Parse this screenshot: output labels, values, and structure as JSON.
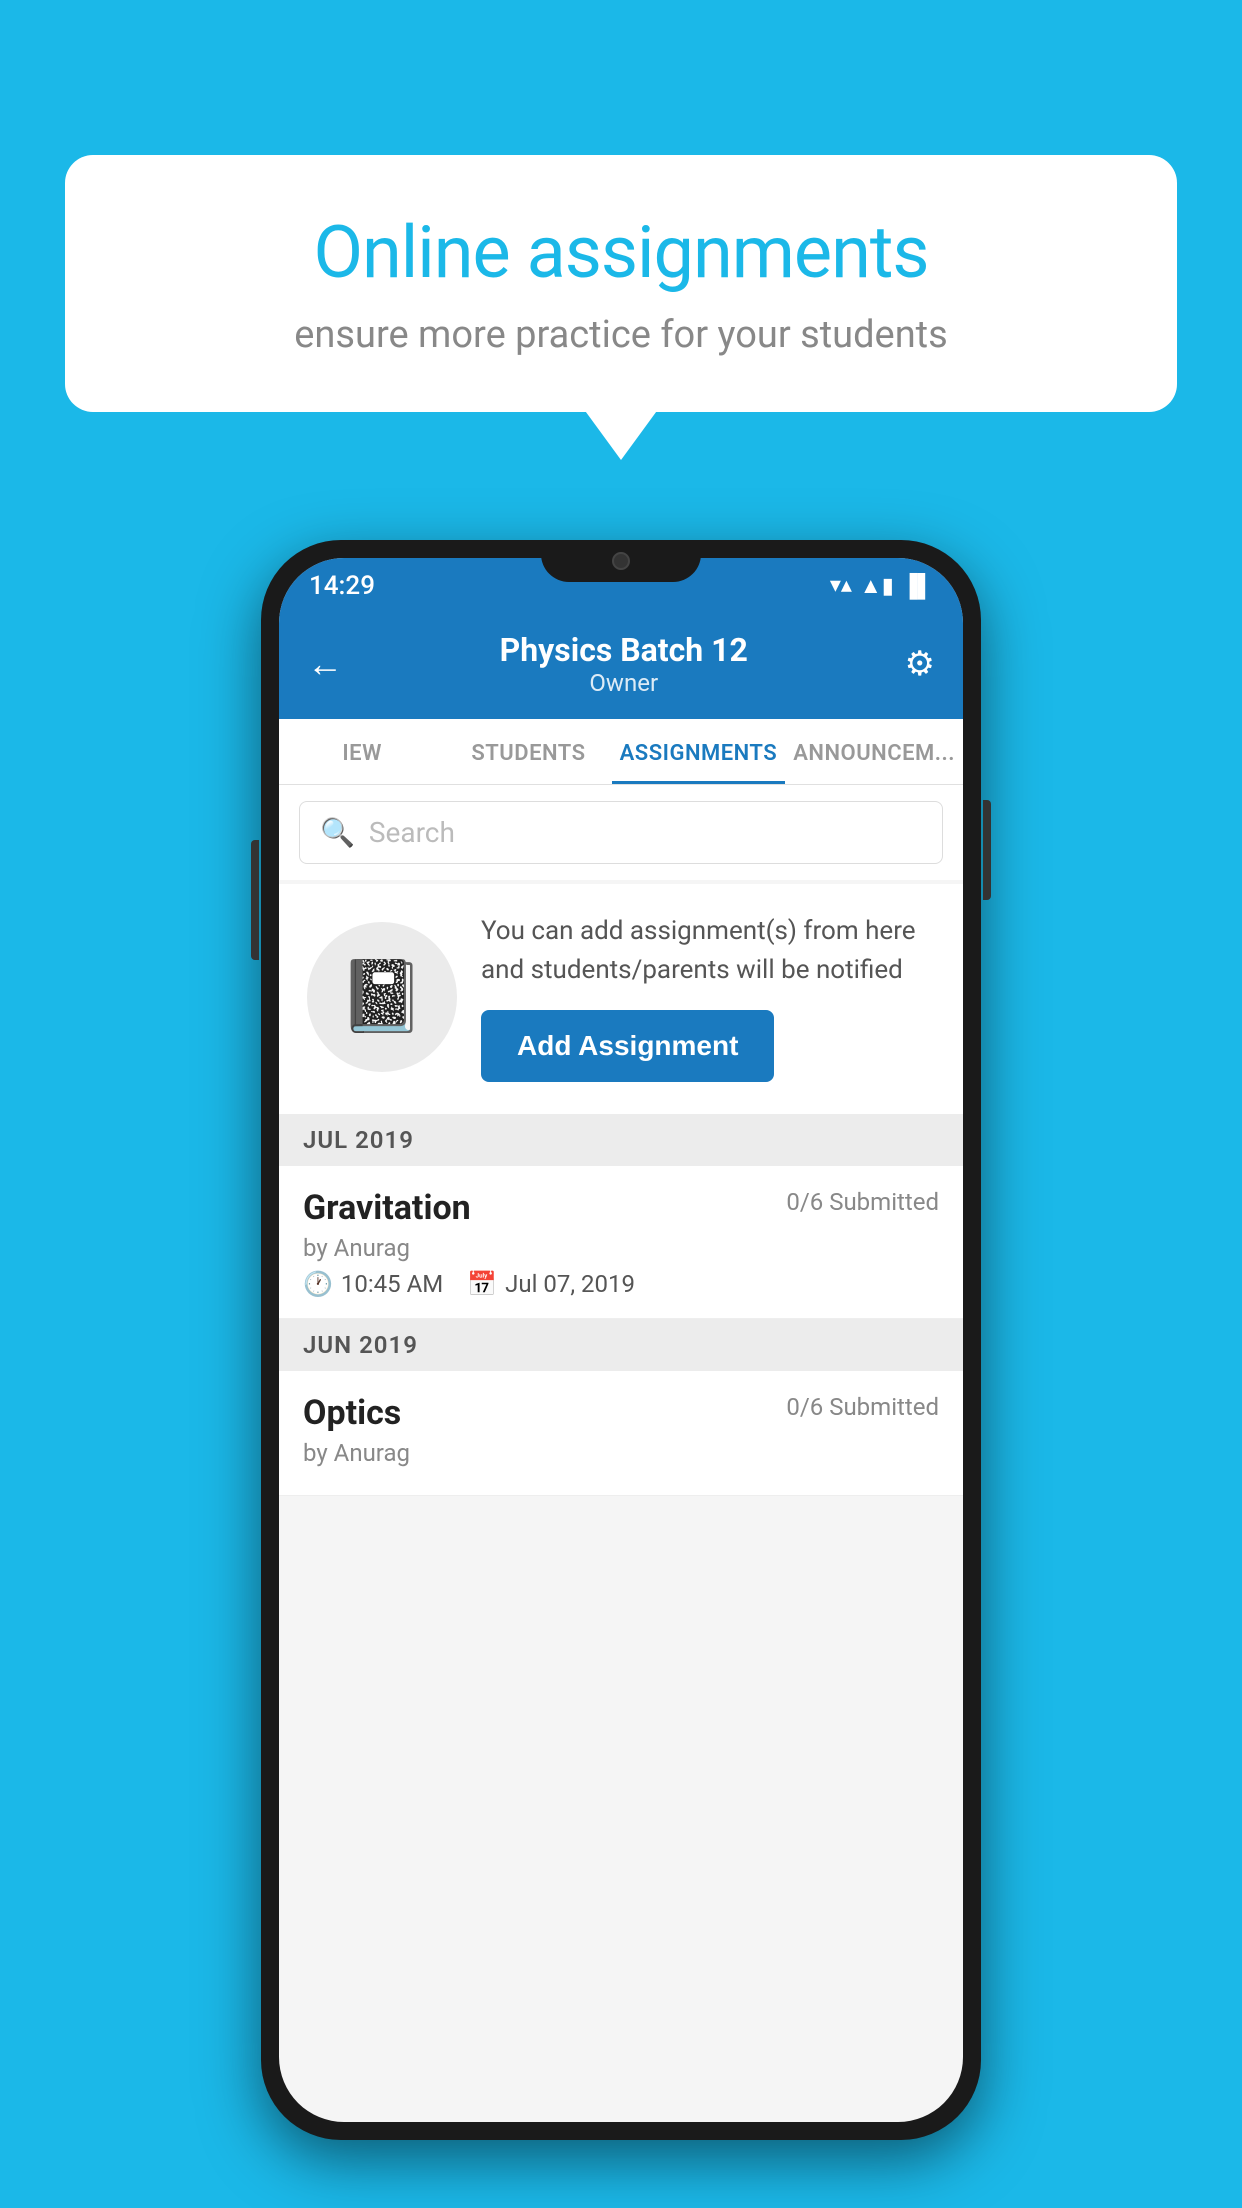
{
  "background": {
    "color": "#1BB8E8"
  },
  "speech_bubble": {
    "title": "Online assignments",
    "subtitle": "ensure more practice for your students"
  },
  "phone": {
    "status_bar": {
      "time": "14:29",
      "wifi": "▼",
      "signal": "▲",
      "battery": "▐"
    },
    "header": {
      "title": "Physics Batch 12",
      "subtitle": "Owner",
      "back_label": "←",
      "settings_label": "⚙"
    },
    "tabs": [
      {
        "label": "IEW",
        "active": false
      },
      {
        "label": "STUDENTS",
        "active": false
      },
      {
        "label": "ASSIGNMENTS",
        "active": true
      },
      {
        "label": "ANNOUNCEM...",
        "active": false
      }
    ],
    "search": {
      "placeholder": "Search"
    },
    "promo": {
      "description": "You can add assignment(s) from here and students/parents will be notified",
      "button_label": "Add Assignment"
    },
    "assignments": [
      {
        "section": "JUL 2019",
        "items": [
          {
            "title": "Gravitation",
            "submitted": "0/6 Submitted",
            "by": "by Anurag",
            "time": "10:45 AM",
            "date": "Jul 07, 2019"
          }
        ]
      },
      {
        "section": "JUN 2019",
        "items": [
          {
            "title": "Optics",
            "submitted": "0/6 Submitted",
            "by": "by Anurag",
            "time": "",
            "date": ""
          }
        ]
      }
    ]
  }
}
